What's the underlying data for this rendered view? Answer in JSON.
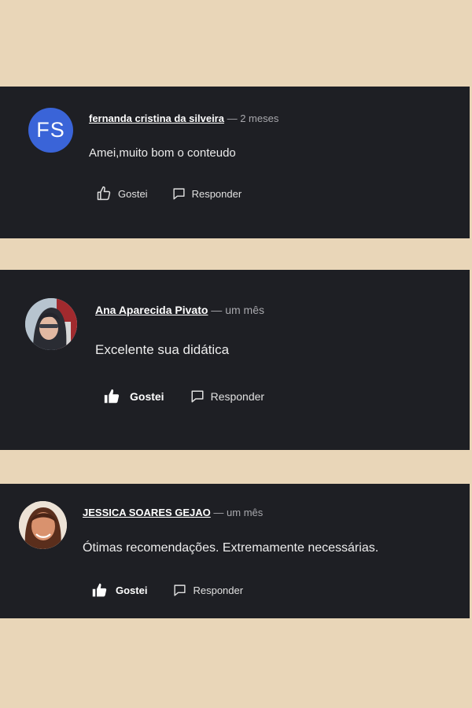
{
  "comments": [
    {
      "author": "fernanda cristina da silveira",
      "separator": " — ",
      "time": "2 meses",
      "text": "Amei,muito bom o conteudo",
      "avatar_initials": "FS",
      "avatar_color": "#3a64d8",
      "like_label": "Gostei",
      "reply_label": "Responder",
      "liked": false
    },
    {
      "author": "Ana Aparecida Pivato",
      "separator": " — ",
      "time": "um mês",
      "text": "Excelente sua didática",
      "avatar_initials": "",
      "like_label": "Gostei",
      "reply_label": "Responder",
      "liked": true
    },
    {
      "author": "JESSICA SOARES GEJAO",
      "separator": " — ",
      "time": "um mês",
      "text": "Ótimas recomendações. Extremamente necessárias.",
      "avatar_initials": "",
      "like_label": "Gostei",
      "reply_label": "Responder",
      "liked": true
    }
  ],
  "colors": {
    "page_background": "#e9d6b8",
    "card_background": "#1e1f24",
    "timestamp": "#a8a8ad"
  },
  "icons": [
    "thumbs-up-outline-icon",
    "thumbs-up-filled-icon",
    "speech-bubble-icon"
  ]
}
